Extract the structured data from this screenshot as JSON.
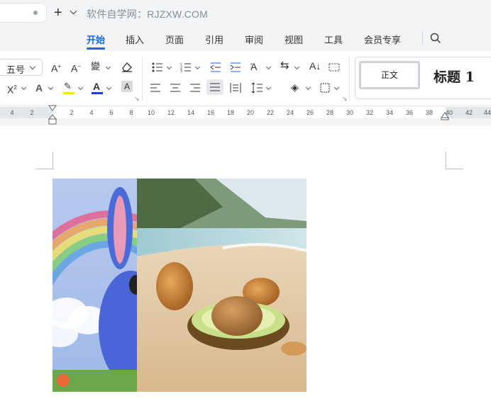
{
  "watermark": "软件自学网：RJZXW.COM",
  "menu": {
    "items": [
      "开始",
      "插入",
      "页面",
      "引用",
      "审阅",
      "视图",
      "工具",
      "会员专享"
    ],
    "active": "开始"
  },
  "ribbon": {
    "font_size": "五号",
    "styles": {
      "normal": "正文",
      "heading1": "标题 1"
    }
  },
  "ruler": {
    "left_labels": [
      "4",
      "2"
    ],
    "right_labels": [
      "2",
      "4",
      "6",
      "8",
      "10",
      "12",
      "14",
      "16",
      "18",
      "20",
      "22",
      "24",
      "26",
      "28",
      "30",
      "32",
      "34",
      "36",
      "38",
      "40",
      "42",
      "44"
    ]
  },
  "image": {
    "left_panel": "rainbow with blue bunny",
    "right_panel": "avocados on a beach"
  },
  "colors": {
    "accent": "#1a66e6",
    "highlight": "#f5e60a",
    "font_color": "#1f3fd1",
    "toolbar_bg": "#f3f4f6"
  }
}
